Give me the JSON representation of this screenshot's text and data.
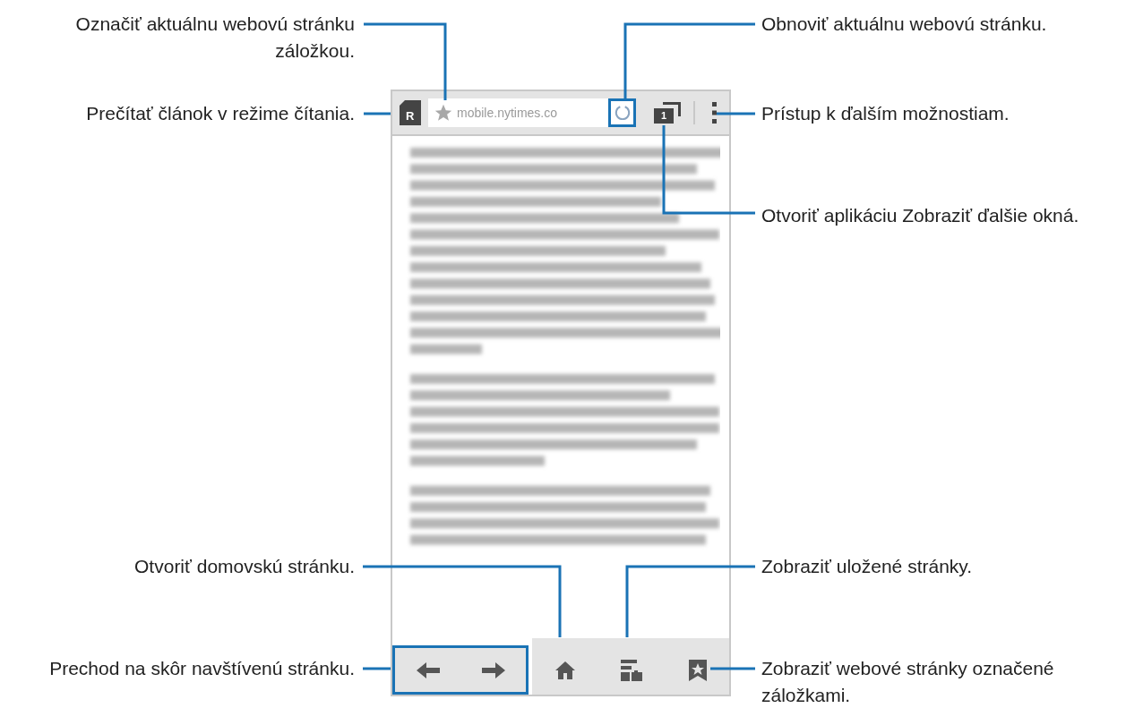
{
  "browser": {
    "url": "mobile.nytimes.co",
    "tab_count": "1",
    "reader_letter": "R"
  },
  "callouts": [
    {
      "text": "Označiť aktuálnu webovú stránku záložkou."
    },
    {
      "text": "Prečítať článok v režime čítania."
    },
    {
      "text": "Obnoviť aktuálnu webovú stránku."
    },
    {
      "text": "Prístup k ďalším možnostiam."
    },
    {
      "text": "Otvoriť aplikáciu Zobraziť ďalšie okná."
    },
    {
      "text": "Otvoriť domovskú stránku."
    },
    {
      "text": "Zobraziť uložené stránky."
    },
    {
      "text": "Prechod na skôr navštívenú stránku."
    },
    {
      "text": "Zobraziť webové stránky označené záložkami."
    }
  ]
}
